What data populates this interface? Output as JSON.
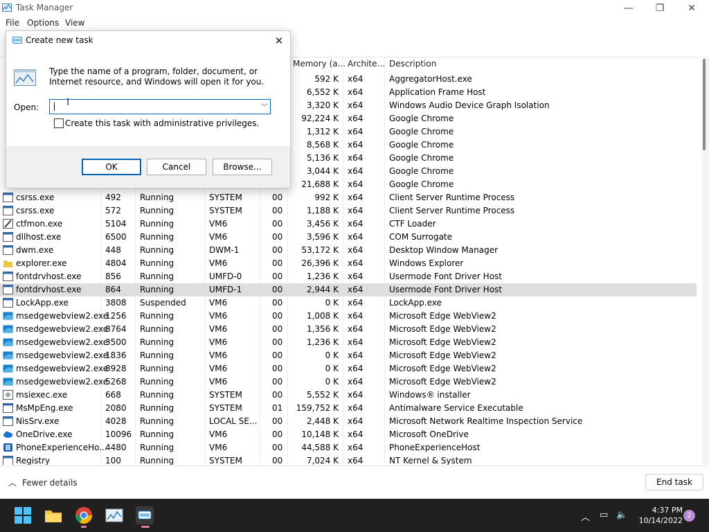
{
  "window": {
    "title": "Task Manager",
    "minimize": "—",
    "maximize": "❐",
    "close": "✕"
  },
  "menu": [
    "File",
    "Options",
    "View"
  ],
  "columns": {
    "memory": "Memory (a...",
    "arch": "Archite...",
    "description": "Description"
  },
  "rows": [
    {
      "name": "",
      "pid": "",
      "status": "",
      "user": "",
      "cpu": "",
      "mem": "592 K",
      "arch": "x64",
      "desc": "AggregatorHost.exe",
      "icon": "gen"
    },
    {
      "name": "",
      "pid": "",
      "status": "",
      "user": "",
      "cpu": "",
      "mem": "6,552 K",
      "arch": "x64",
      "desc": "Application Frame Host",
      "icon": "gen"
    },
    {
      "name": "",
      "pid": "",
      "status": "",
      "user": "",
      "cpu": "",
      "mem": "3,320 K",
      "arch": "x64",
      "desc": "Windows Audio Device Graph Isolation",
      "icon": "gen"
    },
    {
      "name": "",
      "pid": "",
      "status": "",
      "user": "",
      "cpu": "",
      "mem": "92,224 K",
      "arch": "x64",
      "desc": "Google Chrome",
      "icon": "chrome"
    },
    {
      "name": "",
      "pid": "",
      "status": "",
      "user": "",
      "cpu": "",
      "mem": "1,312 K",
      "arch": "x64",
      "desc": "Google Chrome",
      "icon": "chrome"
    },
    {
      "name": "",
      "pid": "",
      "status": "",
      "user": "",
      "cpu": "",
      "mem": "8,568 K",
      "arch": "x64",
      "desc": "Google Chrome",
      "icon": "chrome"
    },
    {
      "name": "",
      "pid": "",
      "status": "",
      "user": "",
      "cpu": "",
      "mem": "5,136 K",
      "arch": "x64",
      "desc": "Google Chrome",
      "icon": "chrome"
    },
    {
      "name": "",
      "pid": "",
      "status": "",
      "user": "",
      "cpu": "",
      "mem": "3,044 K",
      "arch": "x64",
      "desc": "Google Chrome",
      "icon": "chrome"
    },
    {
      "name": "",
      "pid": "",
      "status": "",
      "user": "",
      "cpu": "",
      "mem": "21,688 K",
      "arch": "x64",
      "desc": "Google Chrome",
      "icon": "chrome"
    },
    {
      "name": "csrss.exe",
      "pid": "492",
      "status": "Running",
      "user": "SYSTEM",
      "cpu": "00",
      "mem": "992 K",
      "arch": "x64",
      "desc": "Client Server Runtime Process",
      "icon": "gen"
    },
    {
      "name": "csrss.exe",
      "pid": "572",
      "status": "Running",
      "user": "SYSTEM",
      "cpu": "00",
      "mem": "1,188 K",
      "arch": "x64",
      "desc": "Client Server Runtime Process",
      "icon": "gen"
    },
    {
      "name": "ctfmon.exe",
      "pid": "5104",
      "status": "Running",
      "user": "VM6",
      "cpu": "00",
      "mem": "3,456 K",
      "arch": "x64",
      "desc": "CTF Loader",
      "icon": "pen"
    },
    {
      "name": "dllhost.exe",
      "pid": "6500",
      "status": "Running",
      "user": "VM6",
      "cpu": "00",
      "mem": "3,596 K",
      "arch": "x64",
      "desc": "COM Surrogate",
      "icon": "gen"
    },
    {
      "name": "dwm.exe",
      "pid": "448",
      "status": "Running",
      "user": "DWM-1",
      "cpu": "00",
      "mem": "53,172 K",
      "arch": "x64",
      "desc": "Desktop Window Manager",
      "icon": "gen"
    },
    {
      "name": "explorer.exe",
      "pid": "4804",
      "status": "Running",
      "user": "VM6",
      "cpu": "00",
      "mem": "26,396 K",
      "arch": "x64",
      "desc": "Windows Explorer",
      "icon": "folder"
    },
    {
      "name": "fontdrvhost.exe",
      "pid": "856",
      "status": "Running",
      "user": "UMFD-0",
      "cpu": "00",
      "mem": "1,236 K",
      "arch": "x64",
      "desc": "Usermode Font Driver Host",
      "icon": "gen"
    },
    {
      "name": "fontdrvhost.exe",
      "pid": "864",
      "status": "Running",
      "user": "UMFD-1",
      "cpu": "00",
      "mem": "2,944 K",
      "arch": "x64",
      "desc": "Usermode Font Driver Host",
      "icon": "gen",
      "selected": true
    },
    {
      "name": "LockApp.exe",
      "pid": "3808",
      "status": "Suspended",
      "user": "VM6",
      "cpu": "00",
      "mem": "0 K",
      "arch": "x64",
      "desc": "LockApp.exe",
      "icon": "gen"
    },
    {
      "name": "msedgewebview2.exe",
      "pid": "1256",
      "status": "Running",
      "user": "VM6",
      "cpu": "00",
      "mem": "1,008 K",
      "arch": "x64",
      "desc": "Microsoft Edge WebView2",
      "icon": "edge"
    },
    {
      "name": "msedgewebview2.exe",
      "pid": "8764",
      "status": "Running",
      "user": "VM6",
      "cpu": "00",
      "mem": "1,356 K",
      "arch": "x64",
      "desc": "Microsoft Edge WebView2",
      "icon": "edge"
    },
    {
      "name": "msedgewebview2.exe",
      "pid": "3500",
      "status": "Running",
      "user": "VM6",
      "cpu": "00",
      "mem": "1,236 K",
      "arch": "x64",
      "desc": "Microsoft Edge WebView2",
      "icon": "edge"
    },
    {
      "name": "msedgewebview2.exe",
      "pid": "1836",
      "status": "Running",
      "user": "VM6",
      "cpu": "00",
      "mem": "0 K",
      "arch": "x64",
      "desc": "Microsoft Edge WebView2",
      "icon": "edge"
    },
    {
      "name": "msedgewebview2.exe",
      "pid": "8928",
      "status": "Running",
      "user": "VM6",
      "cpu": "00",
      "mem": "0 K",
      "arch": "x64",
      "desc": "Microsoft Edge WebView2",
      "icon": "edge"
    },
    {
      "name": "msedgewebview2.exe",
      "pid": "5268",
      "status": "Running",
      "user": "VM6",
      "cpu": "00",
      "mem": "0 K",
      "arch": "x64",
      "desc": "Microsoft Edge WebView2",
      "icon": "edge"
    },
    {
      "name": "msiexec.exe",
      "pid": "668",
      "status": "Running",
      "user": "SYSTEM",
      "cpu": "00",
      "mem": "5,552 K",
      "arch": "x64",
      "desc": "Windows® installer",
      "icon": "msi"
    },
    {
      "name": "MsMpEng.exe",
      "pid": "2080",
      "status": "Running",
      "user": "SYSTEM",
      "cpu": "01",
      "mem": "159,752 K",
      "arch": "x64",
      "desc": "Antimalware Service Executable",
      "icon": "gen"
    },
    {
      "name": "NisSrv.exe",
      "pid": "4028",
      "status": "Running",
      "user": "LOCAL SE...",
      "cpu": "00",
      "mem": "2,448 K",
      "arch": "x64",
      "desc": "Microsoft Network Realtime Inspection Service",
      "icon": "gen"
    },
    {
      "name": "OneDrive.exe",
      "pid": "10096",
      "status": "Running",
      "user": "VM6",
      "cpu": "00",
      "mem": "10,148 K",
      "arch": "x64",
      "desc": "Microsoft OneDrive",
      "icon": "cloud"
    },
    {
      "name": "PhoneExperienceHo...",
      "pid": "4480",
      "status": "Running",
      "user": "VM6",
      "cpu": "00",
      "mem": "44,588 K",
      "arch": "x64",
      "desc": "PhoneExperienceHost",
      "icon": "phone"
    },
    {
      "name": "Registry",
      "pid": "100",
      "status": "Running",
      "user": "SYSTEM",
      "cpu": "00",
      "mem": "7,024 K",
      "arch": "x64",
      "desc": "NT Kernel & System",
      "icon": "gen"
    }
  ],
  "footer": {
    "fewer_details": "Fewer details",
    "end_task": "End task"
  },
  "dialog": {
    "title": "Create new task",
    "message": "Type the name of a program, folder, document, or Internet resource, and Windows will open it for you.",
    "open_label": "Open:",
    "open_value": "",
    "admin_label": "Create this task with administrative privileges.",
    "admin_checked": false,
    "ok": "OK",
    "cancel": "Cancel",
    "browse": "Browse..."
  },
  "taskbar": {
    "apps": [
      "start-icon",
      "file-explorer-icon",
      "chrome-icon",
      "task-manager-icon",
      "run-dialog-icon"
    ],
    "time": "4:37 PM",
    "date": "10/14/2022",
    "notifications": "2"
  }
}
